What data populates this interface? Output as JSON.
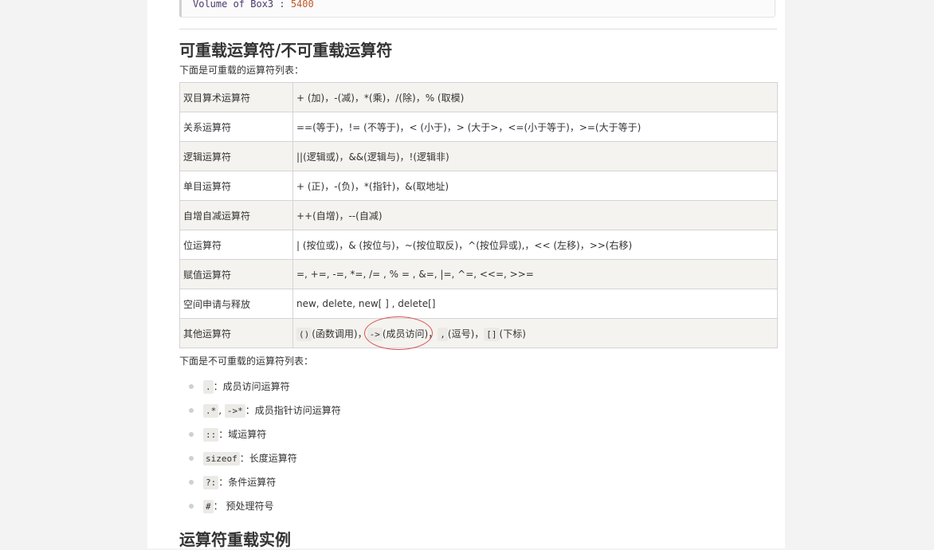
{
  "code": {
    "label": "Volume of Box3 : ",
    "value": "5400"
  },
  "overloadable": {
    "heading": "可重载运算符/不可重载运算符",
    "intro": "下面是可重载的运算符列表：",
    "rows": [
      {
        "category": "双目算术运算符",
        "ops": "+ (加)，-(减)，*(乘)，/(除)，% (取模)"
      },
      {
        "category": "关系运算符",
        "ops": "==(等于)，!= (不等于)，< (小于)，> (大于>，<=(小于等于)，>=(大于等于)"
      },
      {
        "category": "逻辑运算符",
        "ops": "||(逻辑或)，&&(逻辑与)，!(逻辑非)"
      },
      {
        "category": "单目运算符",
        "ops": "+ (正)，-(负)，*(指针)，&(取地址)"
      },
      {
        "category": "自增自减运算符",
        "ops": "++(自增)，--(自减)"
      },
      {
        "category": "位运算符",
        "ops": "| (按位或)，& (按位与)，~(按位取反)，^(按位异或),，<< (左移)，>>(右移)"
      },
      {
        "category": "赋值运算符",
        "ops": "=, +=, -=, *=, /= , % = , &=, |=, ^=, <<=, >>="
      },
      {
        "category": "空间申请与释放",
        "ops": "new, delete, new[ ] , delete[]"
      },
      {
        "category": "其他运算符",
        "ops": ""
      }
    ],
    "other_row": {
      "call_op": "()",
      "call_label": "(函数调用)，",
      "member_op": "->",
      "member_label": "(成员访问)",
      "comma_sep": "，",
      "comma_op": ",",
      "comma_label": "(逗号)，",
      "index_op": "[]",
      "index_label": "(下标)"
    }
  },
  "non_overloadable": {
    "intro": "下面是不可重载的运算符列表：",
    "items": [
      {
        "codes": [
          "."
        ],
        "sep": "",
        "desc": "：成员访问运算符"
      },
      {
        "codes": [
          ".*",
          "->*"
        ],
        "sep": ", ",
        "desc": "：成员指针访问运算符"
      },
      {
        "codes": [
          "::"
        ],
        "sep": "",
        "desc": "：域运算符"
      },
      {
        "codes": [
          "sizeof"
        ],
        "sep": "",
        "desc": "：长度运算符"
      },
      {
        "codes": [
          "?:"
        ],
        "sep": "",
        "desc": "：条件运算符"
      },
      {
        "codes": [
          "#"
        ],
        "sep": "",
        "desc": "： 预处理符号"
      }
    ]
  },
  "example_heading": "运算符重载实例"
}
